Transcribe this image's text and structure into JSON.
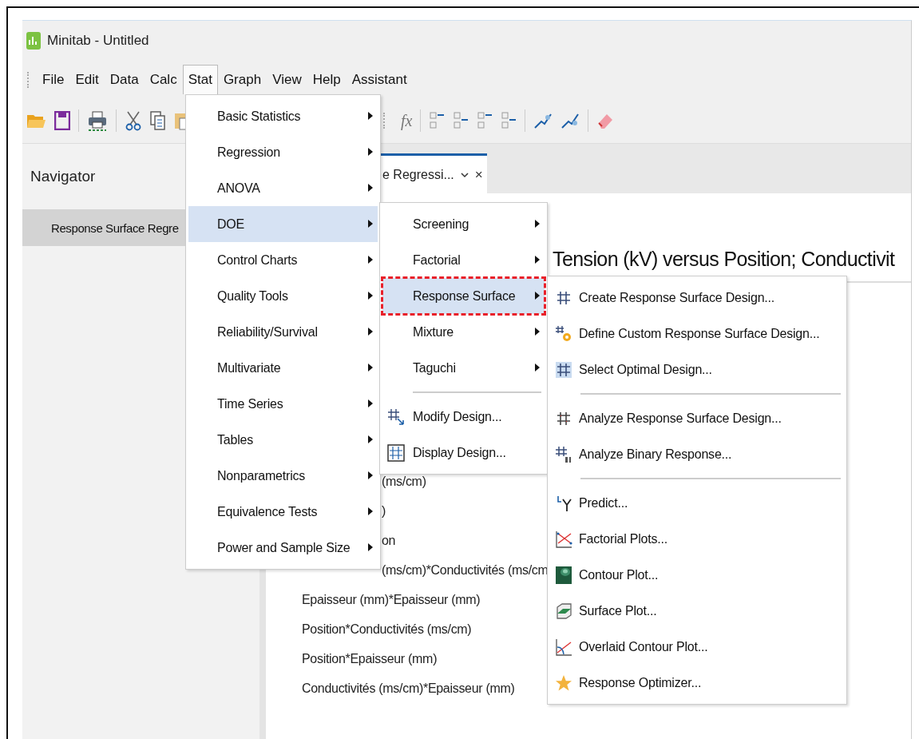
{
  "window": {
    "title": "Minitab - Untitled"
  },
  "menu_bar": [
    {
      "label": "File",
      "selected": false
    },
    {
      "label": "Edit",
      "selected": false
    },
    {
      "label": "Data",
      "selected": false
    },
    {
      "label": "Calc",
      "selected": false
    },
    {
      "label": "Stat",
      "selected": true
    },
    {
      "label": "Graph",
      "selected": false
    },
    {
      "label": "View",
      "selected": false
    },
    {
      "label": "Help",
      "selected": false
    },
    {
      "label": "Assistant",
      "selected": false
    }
  ],
  "toolbar": {
    "formula_button": "fx"
  },
  "navigator": {
    "title": "Navigator",
    "items": [
      {
        "label": "Response Surface Regre",
        "selected": true
      }
    ]
  },
  "tab": {
    "label": "e Regressi...",
    "close": "×"
  },
  "output": {
    "title": "Tension (kV) versus Position; Conductivit",
    "terms": [
      "(ms/cm)",
      ")",
      "on",
      "(ms/cm)*Conductivités (ms/cm",
      "Epaisseur (mm)*Epaisseur (mm)",
      "Position*Conductivités (ms/cm)",
      "Position*Epaisseur (mm)",
      "Conductivités (ms/cm)*Epaisseur (mm)"
    ]
  },
  "stat_menu": [
    {
      "label": "Basic Statistics",
      "selected": false
    },
    {
      "label": "Regression",
      "selected": false
    },
    {
      "label": "ANOVA",
      "selected": false
    },
    {
      "label": "DOE",
      "selected": true
    },
    {
      "label": "Control Charts",
      "selected": false
    },
    {
      "label": "Quality Tools",
      "selected": false
    },
    {
      "label": "Reliability/Survival",
      "selected": false
    },
    {
      "label": "Multivariate",
      "selected": false
    },
    {
      "label": "Time Series",
      "selected": false
    },
    {
      "label": "Tables",
      "selected": false
    },
    {
      "label": "Nonparametrics",
      "selected": false
    },
    {
      "label": "Equivalence Tests",
      "selected": false
    },
    {
      "label": "Power and Sample Size",
      "selected": false
    }
  ],
  "doe_menu": [
    {
      "label": "Screening",
      "kind": "submenu",
      "selected": false,
      "highlighted": false
    },
    {
      "label": "Factorial",
      "kind": "submenu",
      "selected": false,
      "highlighted": false
    },
    {
      "label": "Response Surface",
      "kind": "submenu",
      "selected": true,
      "highlighted": true
    },
    {
      "label": "Mixture",
      "kind": "submenu",
      "selected": false,
      "highlighted": false
    },
    {
      "label": "Taguchi",
      "kind": "submenu",
      "selected": false,
      "highlighted": false
    },
    {
      "label": "Modify Design...",
      "kind": "command",
      "separator_before": true,
      "selected": false,
      "highlighted": false
    },
    {
      "label": "Display Design...",
      "kind": "command",
      "selected": false,
      "highlighted": false
    }
  ],
  "response_surface_menu": [
    {
      "label": "Create Response Surface Design..."
    },
    {
      "label": "Define Custom Response Surface Design..."
    },
    {
      "label": "Select Optimal Design..."
    },
    {
      "label": "Analyze Response Surface Design...",
      "separator_before": true
    },
    {
      "label": "Analyze Binary Response..."
    },
    {
      "label": "Predict...",
      "separator_before": true
    },
    {
      "label": "Factorial Plots..."
    },
    {
      "label": "Contour Plot..."
    },
    {
      "label": "Surface Plot..."
    },
    {
      "label": "Overlaid Contour Plot..."
    },
    {
      "label": "Response Optimizer..."
    }
  ]
}
